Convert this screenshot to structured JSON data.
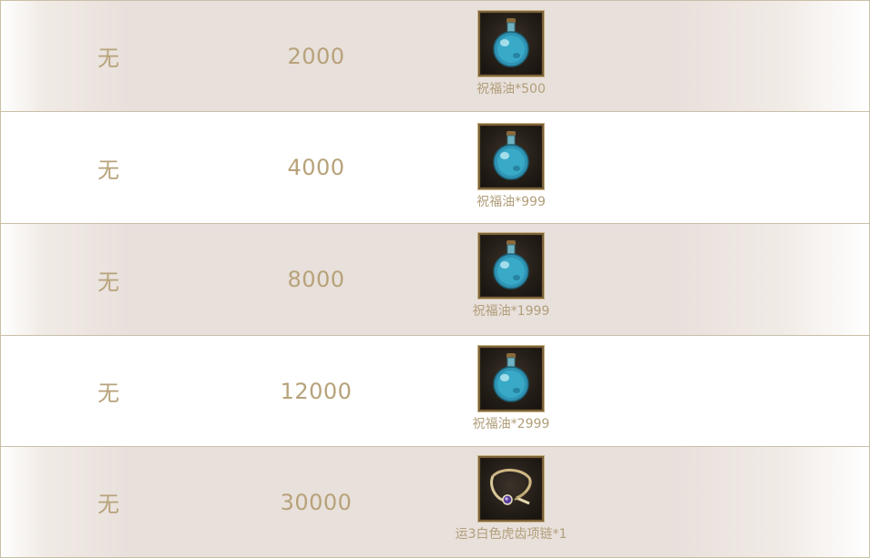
{
  "rows": [
    {
      "col_a": "无",
      "col_b": "2000",
      "reward": {
        "icon": "blessing-oil-icon",
        "label": "祝福油*500"
      }
    },
    {
      "col_a": "无",
      "col_b": "4000",
      "reward": {
        "icon": "blessing-oil-icon",
        "label": "祝福油*999"
      }
    },
    {
      "col_a": "无",
      "col_b": "8000",
      "reward": {
        "icon": "blessing-oil-icon",
        "label": "祝福油*1999"
      }
    },
    {
      "col_a": "无",
      "col_b": "12000",
      "reward": {
        "icon": "blessing-oil-icon",
        "label": "祝福油*2999"
      }
    },
    {
      "col_a": "无",
      "col_b": "30000",
      "reward": {
        "icon": "necklace-icon",
        "label": "运3白色虎齿项链*1"
      }
    }
  ],
  "colors": {
    "text_gold": "#b7a27a",
    "row_shade": "#e8e0db",
    "border": "#c9bfa8",
    "slot_frame": "#7b6238"
  }
}
